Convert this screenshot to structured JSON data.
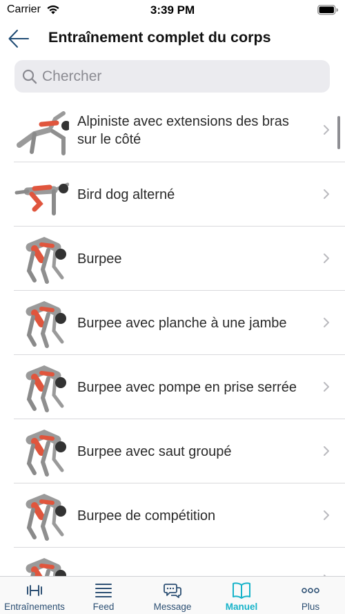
{
  "status": {
    "carrier": "Carrier",
    "time": "3:39 PM"
  },
  "header": {
    "title": "Entraînement complet du corps"
  },
  "search": {
    "placeholder": "Chercher"
  },
  "exercises": [
    {
      "label": "Alpiniste avec extensions des bras sur le côté",
      "pose": "plank"
    },
    {
      "label": "Bird dog alterné",
      "pose": "quadruped"
    },
    {
      "label": "Burpee",
      "pose": "crouch"
    },
    {
      "label": "Burpee avec planche à une jambe",
      "pose": "crouch"
    },
    {
      "label": "Burpee avec pompe en prise serrée",
      "pose": "crouch"
    },
    {
      "label": "Burpee avec saut groupé",
      "pose": "crouch"
    },
    {
      "label": "Burpee de compétition",
      "pose": "crouch"
    },
    {
      "label": "",
      "pose": "crouch"
    }
  ],
  "tabs": [
    {
      "label": "Entraînements",
      "icon": "dumbbell-icon",
      "active": false
    },
    {
      "label": "Feed",
      "icon": "feed-lines-icon",
      "active": false
    },
    {
      "label": "Message",
      "icon": "chat-bubbles-icon",
      "active": false
    },
    {
      "label": "Manuel",
      "icon": "book-icon",
      "active": true
    },
    {
      "label": "Plus",
      "icon": "more-dots-icon",
      "active": false
    }
  ],
  "colors": {
    "accent": "#17b3c9",
    "tab_inactive": "#2c4f73",
    "muscle_highlight": "#e0553d",
    "body": "#9a9a9a"
  }
}
